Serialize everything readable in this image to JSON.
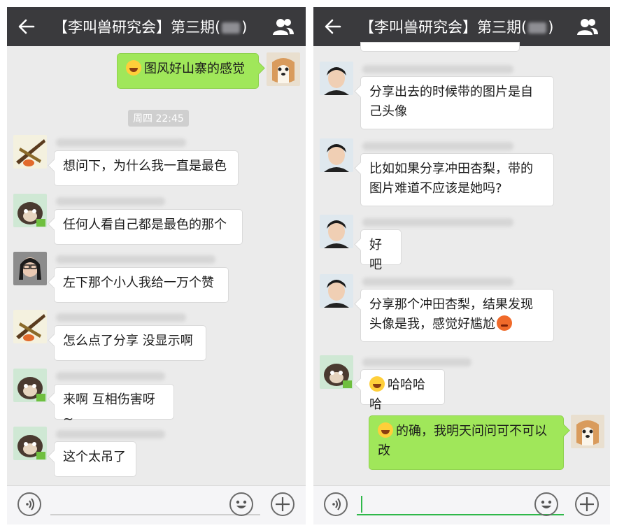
{
  "chat_title": "【李叫兽研究会】第三期(",
  "chat_title_suffix": ")",
  "left": {
    "my_message": "图风好山寨的感觉",
    "timestamp": "周四 22:45",
    "messages": [
      {
        "text": "想问下，为什么我一直是最色"
      },
      {
        "text": "任何人看自己都是最色的那个"
      },
      {
        "text": "左下那个小人我给一万个赞"
      },
      {
        "text": "怎么点了分享 没显示啊"
      },
      {
        "text": "来啊 互相伤害呀~"
      },
      {
        "text": "这个太吊了"
      }
    ]
  },
  "right": {
    "messages": [
      {
        "line1": "分享出去的时候带的图片是自",
        "line2": "己头像"
      },
      {
        "line1": "比如如果分享冲田杏梨，带的",
        "line2": "图片难道不应该是她吗?"
      },
      {
        "line1": "好吧"
      },
      {
        "line1": "分享那个冲田杏梨，结果发现",
        "line2": "头像是我，感觉好尴尬"
      },
      {
        "line1": "哈哈哈哈"
      }
    ],
    "my_message_line1": "的确，我明天问问可不可以",
    "my_message_line2": "改"
  },
  "icons": {
    "back": "arrow-left-icon",
    "contacts": "people-icon",
    "voice": "voice-icon",
    "emoji": "smiley-icon",
    "more": "plus-icon"
  },
  "colors": {
    "topbar": "#3a3a3d",
    "chat_bg": "#ebebeb",
    "my_bubble": "#a0e75a",
    "input_active": "#2fb84a"
  }
}
